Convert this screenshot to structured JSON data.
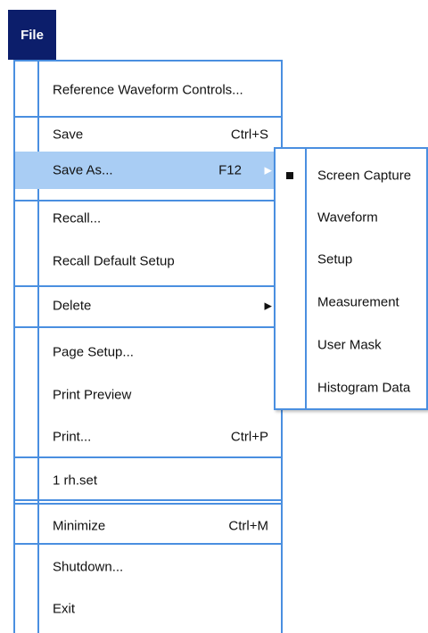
{
  "file_menu": {
    "label": "File"
  },
  "main_menu": {
    "items": [
      {
        "label": "Reference Waveform Controls...",
        "accel": ""
      },
      {
        "label": "Save",
        "accel": "Ctrl+S"
      },
      {
        "label": "Save As...",
        "accel": "F12"
      },
      {
        "label": "Recall...",
        "accel": ""
      },
      {
        "label": "Recall Default Setup",
        "accel": ""
      },
      {
        "label": "Delete",
        "accel": ""
      },
      {
        "label": "Page Setup...",
        "accel": ""
      },
      {
        "label": "Print Preview",
        "accel": ""
      },
      {
        "label": "Print...",
        "accel": "Ctrl+P"
      },
      {
        "label": "1 rh.set",
        "accel": ""
      },
      {
        "label": "Minimize",
        "accel": "Ctrl+M"
      },
      {
        "label": "Shutdown...",
        "accel": ""
      },
      {
        "label": "Exit",
        "accel": ""
      }
    ]
  },
  "save_as_submenu": {
    "items": [
      {
        "label": "Screen Capture",
        "checked": true
      },
      {
        "label": "Waveform",
        "checked": false
      },
      {
        "label": "Setup",
        "checked": false
      },
      {
        "label": "Measurement",
        "checked": false
      },
      {
        "label": "User Mask",
        "checked": false
      },
      {
        "label": "Histogram Data",
        "checked": false
      }
    ]
  },
  "colors": {
    "menu_border": "#4a8fe0",
    "highlight": "#a9cdf4",
    "file_button": "#0c1e6b"
  }
}
